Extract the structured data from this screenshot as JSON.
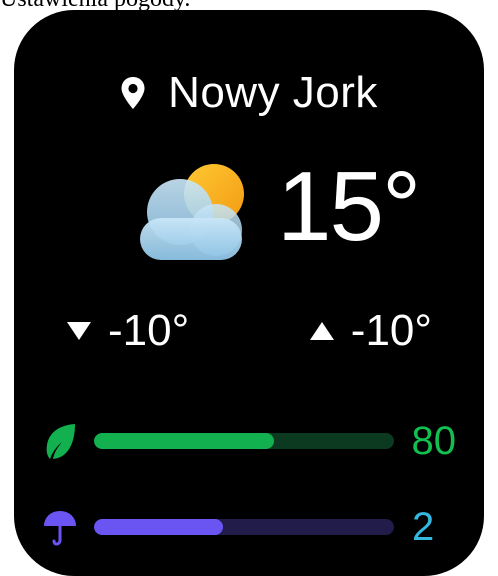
{
  "caption": "Ustawienia pogody.",
  "location": {
    "name": "Nowy Jork",
    "icon": "location-pin-icon"
  },
  "weather": {
    "icon": "partly-cloudy-icon",
    "temperature": "15°"
  },
  "range": {
    "low": "-10°",
    "high": "-10°",
    "low_icon": "down-triangle-icon",
    "high_icon": "up-triangle-icon"
  },
  "air_quality": {
    "icon": "leaf-icon",
    "value": "80",
    "fill_fraction": 0.6,
    "color": "#12b04f",
    "track_color": "#0c3a21",
    "text_color": "#11c04f"
  },
  "precipitation": {
    "icon": "umbrella-icon",
    "value": "2",
    "fill_fraction": 0.43,
    "color": "#6a55f2",
    "track_color": "#211c4a",
    "text_color": "#34b8df"
  }
}
